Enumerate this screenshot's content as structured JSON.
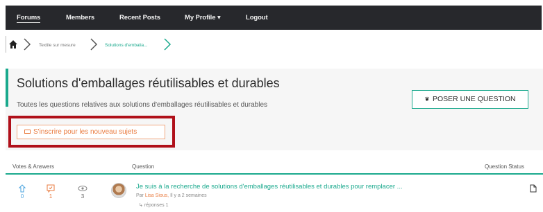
{
  "nav": {
    "items": [
      {
        "label": "Forums"
      },
      {
        "label": "Members"
      },
      {
        "label": "Recent Posts"
      },
      {
        "label": "My Profile ▾"
      },
      {
        "label": "Logout"
      }
    ]
  },
  "breadcrumb": {
    "items": [
      "Textile sur mesure",
      "Solutions d'embalia..."
    ]
  },
  "header": {
    "title": "Solutions d'emballages réutilisables et durables",
    "description": "Toutes les questions relatives aux solutions d'emballages réutilisables et durables",
    "ask_button": "POSER UNE QUESTION",
    "subscribe_button": "S'inscrire pour les nouveau sujets"
  },
  "table": {
    "columns": {
      "votes": "Votes & Answers",
      "question": "Question",
      "status": "Question Status"
    },
    "rows": [
      {
        "votes": "0",
        "answers": "1",
        "views": "3",
        "title": "Je suis à la recherche de solutions d'emballages réutilisables et durables pour remplacer ...",
        "author_prefix": "Par",
        "author": "Lisa Sious,",
        "time": "Il y a 2 semaines",
        "replies": "réponses 1"
      }
    ]
  },
  "colors": {
    "accent": "#1aa98d",
    "orange": "#e97a3e",
    "nav_bg": "#27282c",
    "highlight": "#b0101a"
  },
  "icons": [
    "home-icon",
    "chevron-right-icon",
    "leaf-icon",
    "envelope-icon",
    "vote-icon",
    "answer-icon",
    "eye-icon",
    "reply-arrow-icon",
    "document-icon"
  ]
}
